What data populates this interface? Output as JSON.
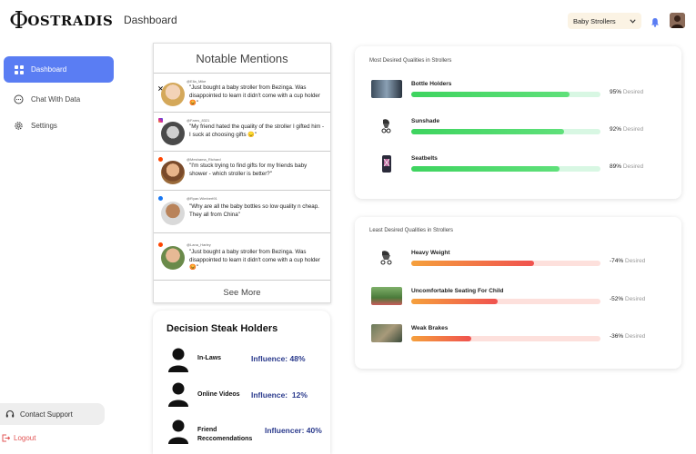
{
  "brand": {
    "logo_symbol": "Φ",
    "logo_text": "OSTRADIS"
  },
  "sidebar": {
    "items": [
      {
        "label": "Dashboard",
        "icon": "grid-icon",
        "active": true
      },
      {
        "label": "Chat With Data",
        "icon": "chat-icon",
        "active": false
      },
      {
        "label": "Settings",
        "icon": "gear-icon",
        "active": false
      }
    ],
    "support_label": "Contact Support",
    "logout_label": "Logout"
  },
  "header": {
    "title": "Dashboard",
    "filter_value": "Baby Strollers",
    "accent": "#5a7df3"
  },
  "mentions": {
    "title": "Notable Mentions",
    "see_more": "See More",
    "items": [
      {
        "source": "x",
        "handle": "@Ella_Mike",
        "quote": "\"Just bought a baby stroller from Bezinga. Was disappointed to learn it didn't come with a cup holder 😡\""
      },
      {
        "source": "instagram",
        "handle": "@Fares_8321",
        "quote": "\"My friend hated the quality of the stroller I gifted him - I suck at choosing gifts 😞\""
      },
      {
        "source": "reddit",
        "handle": "@Meshama_Richard",
        "quote": "\"I'm stuck trying to find gifts for my friends baby shower - which stroller is better?\""
      },
      {
        "source": "facebook",
        "handle": "@Ryan.Wimbert91",
        "quote": "\"Why are all the baby bottles so low quality n cheap. They all from China\""
      },
      {
        "source": "reddit",
        "handle": "@Lana_Harley",
        "quote": "\"Just bought a baby stroller from Bezinga. Was disappointed to learn it didn't come with a cup holder 😡\""
      }
    ]
  },
  "stakeholders": {
    "title": "Decision Steak Holders",
    "items": [
      {
        "who": "In-Laws",
        "influence": "Influence: 48%"
      },
      {
        "who": "Online Videos",
        "influence": "Influence:  12%"
      },
      {
        "who_line1": "Friend",
        "who_line2": "Reccomendations",
        "influence": "Influencer: 40%"
      }
    ]
  },
  "most_desired": {
    "title": "Most Desired Qualities in Strollers",
    "items": [
      {
        "label": "Bottle Holders",
        "value": 95,
        "pct": "95%",
        "suffix": "Desired",
        "icon": "bottle-photo"
      },
      {
        "label": "Sunshade",
        "value": 92,
        "pct": "92%",
        "suffix": "Desired",
        "icon": "stroller-icon"
      },
      {
        "label": "Seatbelts",
        "value": 89,
        "pct": "89%",
        "suffix": "Desired",
        "icon": "seat-icon"
      }
    ],
    "bar_color": "#4cd96b",
    "track_color": "#d8f7e3"
  },
  "least_desired": {
    "title": "Least Desired Qualities in Strollers",
    "items": [
      {
        "label": "Heavy Weight",
        "value": 74,
        "pct": "-74%",
        "suffix": "Desired",
        "icon": "stroller-icon"
      },
      {
        "label": "Uncomfortable Seating For Child",
        "value": 52,
        "pct": "-52%",
        "suffix": "Desired",
        "icon": "seating-photo"
      },
      {
        "label": "Weak Brakes",
        "value": 36,
        "pct": "-36%",
        "suffix": "Desired",
        "icon": "brakes-photo"
      }
    ],
    "bar_color": "#f0524f",
    "bar_color_start": "#f5a03c",
    "track_color": "#fde0dc"
  }
}
